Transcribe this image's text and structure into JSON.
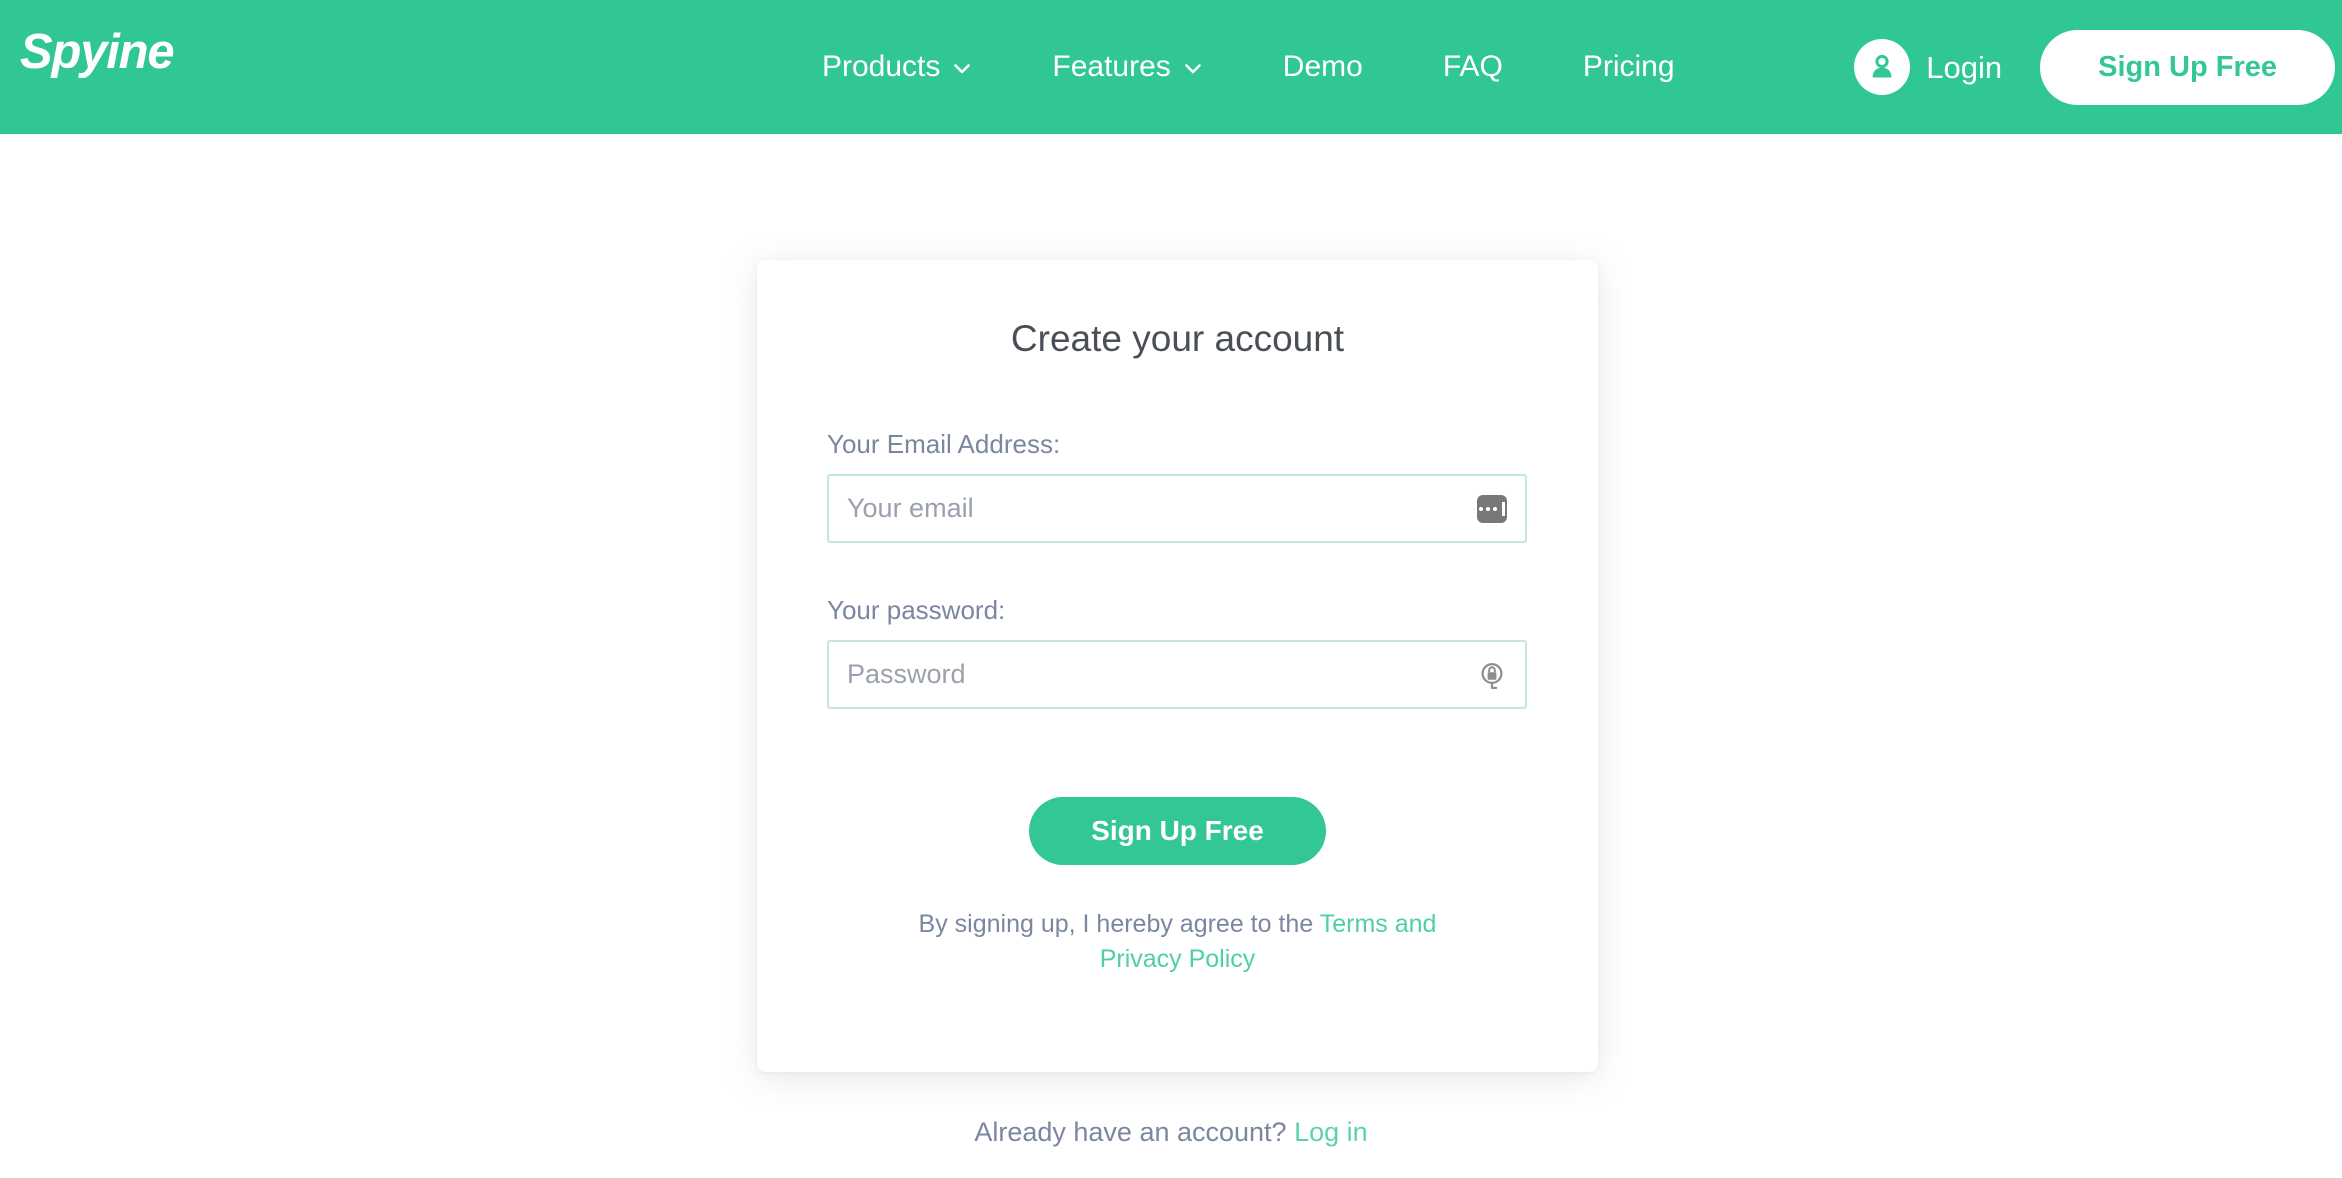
{
  "theme": {
    "brand_green": "#31c793",
    "button_green": "#32c795",
    "link_green": "#4ed0a0",
    "label_gray": "#7b87a0",
    "title_gray": "#4a4f57",
    "input_border": "#c3e8d8"
  },
  "header": {
    "brand": "Spyine",
    "nav": [
      {
        "label": "Products",
        "has_dropdown": true,
        "icon": "chevron-down-icon"
      },
      {
        "label": "Features",
        "has_dropdown": true,
        "icon": "chevron-down-icon"
      },
      {
        "label": "Demo",
        "has_dropdown": false
      },
      {
        "label": "FAQ",
        "has_dropdown": false
      },
      {
        "label": "Pricing",
        "has_dropdown": false
      }
    ],
    "login": {
      "label": "Login",
      "icon": "user-avatar-icon"
    },
    "signup_button": "Sign Up Free"
  },
  "signup_card": {
    "title": "Create your account",
    "email": {
      "label": "Your Email Address:",
      "placeholder": "Your email",
      "value": "",
      "icon": "autofill-dots-icon"
    },
    "password": {
      "label": "Your password:",
      "placeholder": "Password",
      "value": "",
      "icon": "password-key-icon"
    },
    "submit_button": "Sign Up Free",
    "terms": {
      "prefix": "By signing up, I hereby agree to the ",
      "link": "Terms and Privacy Policy"
    }
  },
  "footer_prompt": {
    "text": "Already have an account? ",
    "link": "Log in"
  }
}
